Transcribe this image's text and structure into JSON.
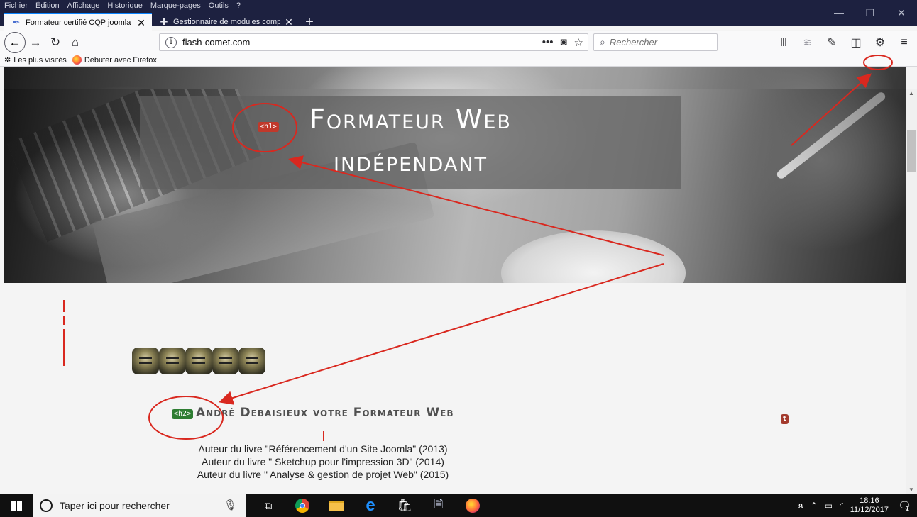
{
  "menu": [
    "Fichier",
    "Édition",
    "Affichage",
    "Historique",
    "Marque-pages",
    "Outils",
    "?"
  ],
  "tabs": [
    {
      "title": "Formateur certifié CQP joomla",
      "active": true
    },
    {
      "title": "Gestionnaire de modules comp",
      "active": false
    }
  ],
  "window_controls": {
    "minimize": "—",
    "restore": "❐",
    "close": "✕"
  },
  "navbar": {
    "url": "flash-comet.com",
    "page_actions": "•••",
    "search_placeholder": "Rechercher"
  },
  "bookmarks": [
    {
      "label": "Les plus visités",
      "icon": "gear-icon"
    },
    {
      "label": "Débuter avec Firefox",
      "icon": "firefox-icon"
    }
  ],
  "page": {
    "hero_title_line1": "Formateur Web",
    "hero_title_line2": "indépendant",
    "tag_h1": "<h1>",
    "tag_h2": "<h2>",
    "tag_t": "t",
    "author_heading": "André Debaisieux votre Formateur Web",
    "books": [
      "Auteur du livre \"Référencement d'un Site Joomla\" (2013)",
      "Auteur du livre \" Sketchup pour l'impression 3D\" (2014)",
      "Auteur du livre \" Analyse & gestion de projet Web\" (2015)"
    ]
  },
  "taskbar": {
    "search_placeholder": "Taper ici pour rechercher",
    "time": "18:16",
    "date": "11/12/2017",
    "notifications": "1"
  },
  "colors": {
    "titlebar": "#1d2140",
    "annotation_red": "#d9281f",
    "h1_tag": "#c0392b",
    "h2_tag": "#2e7d32"
  }
}
